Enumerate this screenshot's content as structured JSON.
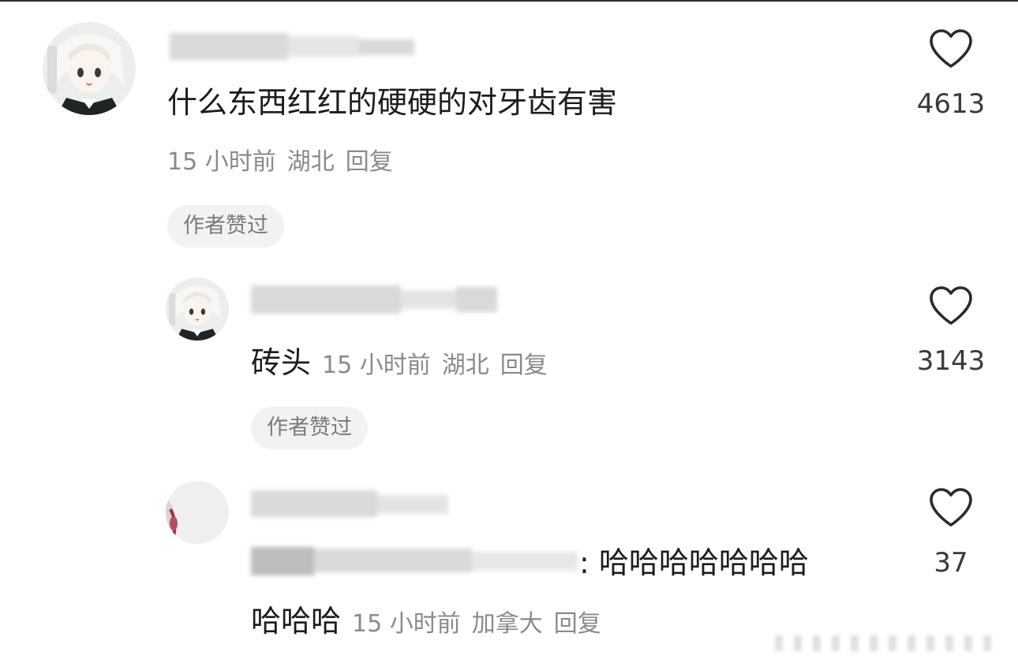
{
  "comments": [
    {
      "text": "什么东西红红的硬硬的对牙齿有害",
      "time": "15 小时前",
      "location": "湖北",
      "reply_label": "回复",
      "badge": "作者赞过",
      "likes": "4613",
      "avatar": "anime-girl-avatar"
    },
    {
      "text": "砖头",
      "time": "15 小时前",
      "location": "湖北",
      "reply_label": "回复",
      "badge": "作者赞过",
      "likes": "3143",
      "avatar": "anime-girl-avatar"
    },
    {
      "text_line1": ": 哈哈哈哈哈哈哈",
      "text_line2": "哈哈哈",
      "time": "15 小时前",
      "location": "加拿大",
      "reply_label": "回复",
      "likes": "37",
      "avatar": "pink-blur-avatar"
    }
  ],
  "icons": {
    "like": "heart-outline-icon"
  },
  "colors": {
    "text": "#1c1c1c",
    "meta": "#8a8a8a",
    "badge_bg": "#f2f2f2"
  }
}
